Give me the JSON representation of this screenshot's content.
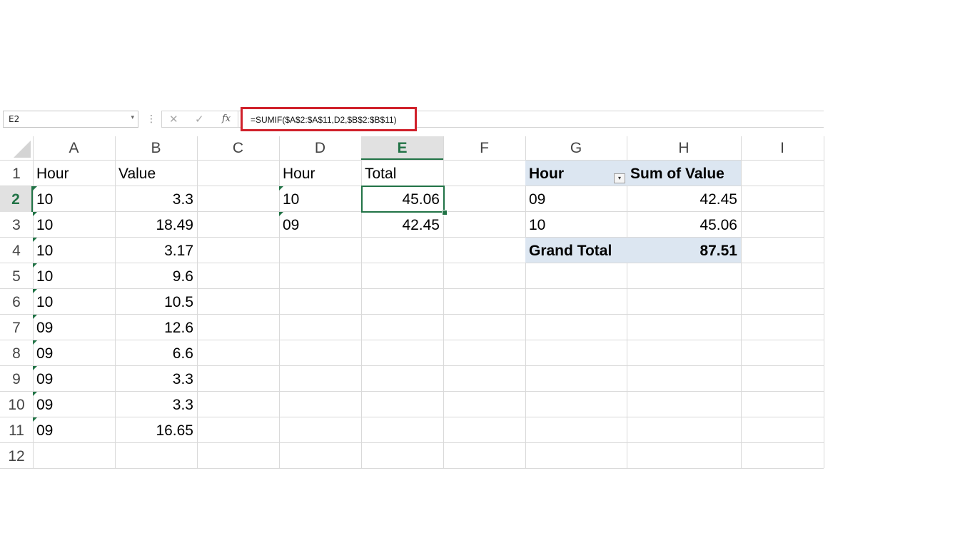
{
  "name_box": {
    "value": "E2",
    "arrow": "▾"
  },
  "formula_bar": {
    "dots": "⋮",
    "cancel_icon": "✕",
    "enter_icon": "✓",
    "fx_icon": "fx",
    "formula": "=SUMIF($A$2:$A$11,D2,$B$2:$B$11)",
    "highlight_color": "#d0202a"
  },
  "columns": [
    "A",
    "B",
    "C",
    "D",
    "E",
    "F",
    "G",
    "H",
    "I"
  ],
  "active_column": "E",
  "rows": [
    "1",
    "2",
    "3",
    "4",
    "5",
    "6",
    "7",
    "8",
    "9",
    "10",
    "11",
    "12"
  ],
  "active_row": "2",
  "source_table": {
    "headers": [
      "Hour",
      "Value"
    ],
    "data": [
      [
        "10",
        "3.3"
      ],
      [
        "10",
        "18.49"
      ],
      [
        "10",
        "3.17"
      ],
      [
        "10",
        "9.6"
      ],
      [
        "10",
        "10.5"
      ],
      [
        "09",
        "12.6"
      ],
      [
        "09",
        "6.6"
      ],
      [
        "09",
        "3.3"
      ],
      [
        "09",
        "3.3"
      ],
      [
        "09",
        "16.65"
      ]
    ]
  },
  "sumif_table": {
    "headers": [
      "Hour",
      "Total"
    ],
    "data": [
      [
        "10",
        "45.06"
      ],
      [
        "09",
        "42.45"
      ]
    ]
  },
  "pivot_table": {
    "headers": [
      "Hour",
      "Sum of Value"
    ],
    "filter_icon": "▾",
    "data": [
      [
        "09",
        "42.45"
      ],
      [
        "10",
        "45.06"
      ]
    ],
    "grand_total_label": "Grand Total",
    "grand_total_value": "87.51",
    "header_bg": "#dce6f1"
  },
  "accent_color": "#217346"
}
